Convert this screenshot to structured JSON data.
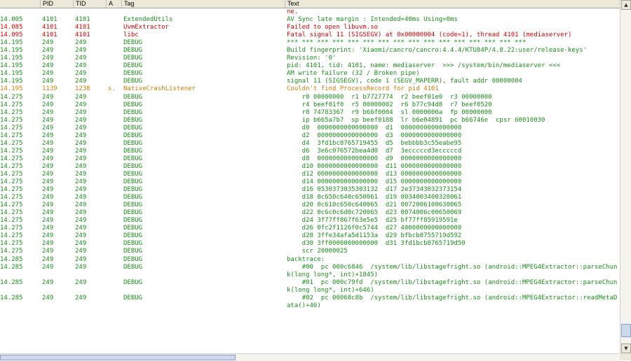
{
  "columns": {
    "time": "",
    "pid": "PID",
    "tid": "TID",
    "level": "A",
    "tag": "Tag",
    "text": "Text"
  },
  "colors": {
    "debug": "#1a8f1a",
    "error": "#e00000",
    "warn": "#e07a00",
    "header_bg": "#ece9d8"
  },
  "scroll": {
    "vertical_position": 0.98,
    "vertical_visible_fraction": 0.04,
    "horizontal_position": 0.0,
    "horizontal_visible_fraction": 0.38
  },
  "log": {
    "rows": [
      {
        "lvl": "E",
        "time": "",
        "pid": "",
        "tid": "",
        "level": "",
        "tag": "",
        "text": "ne."
      },
      {
        "lvl": "D",
        "time": "14.005",
        "pid": "4101",
        "tid": "4101",
        "level": "",
        "tag": "ExtendedUtils",
        "text": "AV Sync late margin : Intended=40ms Using=0ms"
      },
      {
        "lvl": "E",
        "time": "14.085",
        "pid": "4101",
        "tid": "4101",
        "level": "",
        "tag": "UvmExtractor",
        "text": "Failed to open libuvm.so"
      },
      {
        "lvl": "E",
        "time": "14.095",
        "pid": "4101",
        "tid": "4101",
        "level": "",
        "tag": "libc",
        "text": "Fatal signal 11 (SIGSEGV) at 0x00000004 (code=1), thread 4101 (mediaserver)"
      },
      {
        "lvl": "D",
        "time": "14.195",
        "pid": "249",
        "tid": "249",
        "level": "",
        "tag": "DEBUG",
        "text": "*** *** *** *** *** *** *** *** *** *** *** *** *** *** *** ***"
      },
      {
        "lvl": "D",
        "time": "14.195",
        "pid": "249",
        "tid": "249",
        "level": "",
        "tag": "DEBUG",
        "text": "Build fingerprint: 'Xiaomi/cancro/cancro:4.4.4/KTU84P/4.8.22:user/release-keys'"
      },
      {
        "lvl": "D",
        "time": "14.195",
        "pid": "249",
        "tid": "249",
        "level": "",
        "tag": "DEBUG",
        "text": "Revision: '0'"
      },
      {
        "lvl": "D",
        "time": "14.195",
        "pid": "249",
        "tid": "249",
        "level": "",
        "tag": "DEBUG",
        "text": "pid: 4101, tid: 4101, name: mediaserver  >>> /system/bin/mediaserver <<<"
      },
      {
        "lvl": "D",
        "time": "14.195",
        "pid": "249",
        "tid": "249",
        "level": "",
        "tag": "DEBUG",
        "text": "AM write failure (32 / Broken pipe)"
      },
      {
        "lvl": "D",
        "time": "14.195",
        "pid": "249",
        "tid": "249",
        "level": "",
        "tag": "DEBUG",
        "text": "signal 11 (SIGSEGV), code 1 (SEGV_MAPERR), fault addr 00000004"
      },
      {
        "lvl": "W",
        "time": "14.195",
        "pid": "1139",
        "tid": "1238",
        "level": "s.",
        "tag": "NativeCrashListener",
        "text": "Couldn't find ProcessRecord for pid 4101"
      },
      {
        "lvl": "D",
        "time": "14.275",
        "pid": "249",
        "tid": "249",
        "level": "",
        "tag": "DEBUG",
        "text": "    r0 00000000  r1 b7727774  r2 beef01e0  r3 00000000"
      },
      {
        "lvl": "D",
        "time": "14.275",
        "pid": "249",
        "tid": "249",
        "level": "",
        "tag": "DEBUG",
        "text": "    r4 beef01f0  r5 00000002  r6 b77c94d8  r7 beef0520"
      },
      {
        "lvl": "D",
        "time": "14.275",
        "pid": "249",
        "tid": "249",
        "level": "",
        "tag": "DEBUG",
        "text": "    r8 74783367  r9 b66f0004  sl 0000000a  fp 00000000"
      },
      {
        "lvl": "D",
        "time": "14.275",
        "pid": "249",
        "tid": "249",
        "level": "",
        "tag": "DEBUG",
        "text": "    ip b665a7b7  sp beef0188  lr b6e04891  pc b66746e  cpsr 60010030"
      },
      {
        "lvl": "D",
        "time": "14.275",
        "pid": "249",
        "tid": "249",
        "level": "",
        "tag": "DEBUG",
        "text": "    d0  0000000000000000  d1  0000000000000000"
      },
      {
        "lvl": "D",
        "time": "14.275",
        "pid": "249",
        "tid": "249",
        "level": "",
        "tag": "DEBUG",
        "text": "    d2  0000000000000000  d3  0000000000000000"
      },
      {
        "lvl": "D",
        "time": "14.275",
        "pid": "249",
        "tid": "249",
        "level": "",
        "tag": "DEBUG",
        "text": "    d4  3fd1bc8765719455  d5  bebbbb3c55eabe95"
      },
      {
        "lvl": "D",
        "time": "14.275",
        "pid": "249",
        "tid": "249",
        "level": "",
        "tag": "DEBUG",
        "text": "    d6  3e6c076572bea4d0  d7  3ecccccd3ecccccd"
      },
      {
        "lvl": "D",
        "time": "14.275",
        "pid": "249",
        "tid": "249",
        "level": "",
        "tag": "DEBUG",
        "text": "    d8  0000000000000000  d9  0000000000000000"
      },
      {
        "lvl": "D",
        "time": "14.275",
        "pid": "249",
        "tid": "249",
        "level": "",
        "tag": "DEBUG",
        "text": "    d10 0000000000000000  d11 0000000000000000"
      },
      {
        "lvl": "D",
        "time": "14.275",
        "pid": "249",
        "tid": "249",
        "level": "",
        "tag": "DEBUG",
        "text": "    d12 0000000000000000  d13 0000000000000000"
      },
      {
        "lvl": "D",
        "time": "14.275",
        "pid": "249",
        "tid": "249",
        "level": "",
        "tag": "DEBUG",
        "text": "    d14 0000000000000000  d15 0000000000000000"
      },
      {
        "lvl": "D",
        "time": "14.275",
        "pid": "249",
        "tid": "249",
        "level": "",
        "tag": "DEBUG",
        "text": "    d16 0530373035303132  d17 2e37343032373154"
      },
      {
        "lvl": "D",
        "time": "14.275",
        "pid": "249",
        "tid": "249",
        "level": "",
        "tag": "DEBUG",
        "text": "    d18 0c650c640c650061  d19 0034003400320061"
      },
      {
        "lvl": "D",
        "time": "14.275",
        "pid": "249",
        "tid": "249",
        "level": "",
        "tag": "DEBUG",
        "text": "    d20 0c610c650c640065  d21 0072006100630065"
      },
      {
        "lvl": "D",
        "time": "14.275",
        "pid": "249",
        "tid": "249",
        "level": "",
        "tag": "DEBUG",
        "text": "    d22 0c6c0c6d0c720065  d23 0074006c00650069"
      },
      {
        "lvl": "D",
        "time": "14.275",
        "pid": "249",
        "tid": "249",
        "level": "",
        "tag": "DEBUG",
        "text": "    d24 3f77ff867f63e5e5  d25 bf77ff85919591e"
      },
      {
        "lvl": "D",
        "time": "14.275",
        "pid": "249",
        "tid": "249",
        "level": "",
        "tag": "DEBUG",
        "text": "    d26 0fc2f1126f0c5744  d27 4000000000000000"
      },
      {
        "lvl": "D",
        "time": "14.275",
        "pid": "249",
        "tid": "249",
        "level": "",
        "tag": "DEBUG",
        "text": "    d28 3ffe34afa5d1153a  d29 bfbcb8755719d592"
      },
      {
        "lvl": "D",
        "time": "14.275",
        "pid": "249",
        "tid": "249",
        "level": "",
        "tag": "DEBUG",
        "text": "    d30 3ff0000000000000  d31 3fd1bcb8765719d50"
      },
      {
        "lvl": "D",
        "time": "14.275",
        "pid": "249",
        "tid": "249",
        "level": "",
        "tag": "DEBUG",
        "text": "    scr 20000025"
      },
      {
        "lvl": "D",
        "time": "14.285",
        "pid": "249",
        "tid": "249",
        "level": "",
        "tag": "DEBUG",
        "text": "backtrace:"
      },
      {
        "lvl": "D",
        "time": "14.285",
        "pid": "249",
        "tid": "249",
        "level": "",
        "tag": "DEBUG",
        "wrap": true,
        "text": "    #00  pc 000c6846  /system/lib/libstagefright.so (android::MPEG4Extractor::parseChunk(long long*, int)+1845)"
      },
      {
        "lvl": "D",
        "time": "14.285",
        "pid": "249",
        "tid": "249",
        "level": "",
        "tag": "DEBUG",
        "wrap": true,
        "text": "    #01  pc 000c79fd  /system/lib/libstagefright.so (android::MPEG4Extractor::parseChunk(long long*, int)+646)"
      },
      {
        "lvl": "D",
        "time": "14.285",
        "pid": "249",
        "tid": "249",
        "level": "",
        "tag": "DEBUG",
        "wrap": true,
        "text": "    #02  pc 00068c8b  /system/lib/libstagefright.so (android::MPEG4Extractor::readMetaData()+46)"
      }
    ]
  }
}
